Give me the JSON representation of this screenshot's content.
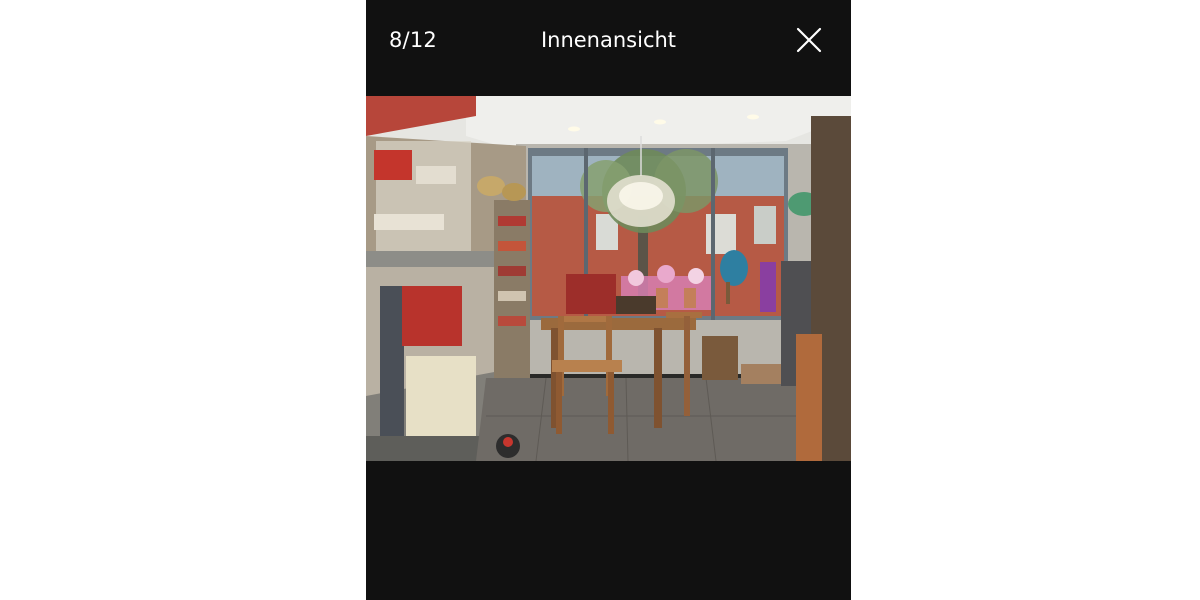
{
  "viewer": {
    "counter": "8/12",
    "title": "Innenansicht",
    "close_icon": "close-icon",
    "background_color": "#111111",
    "text_color": "#ffffff"
  },
  "photo": {
    "subject": "shop-interior-photo"
  }
}
